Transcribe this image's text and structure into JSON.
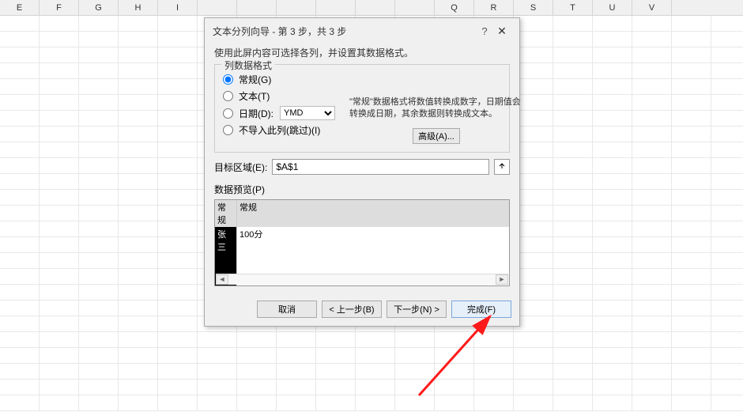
{
  "columns": [
    "E",
    "F",
    "G",
    "H",
    "I",
    "",
    "",
    "",
    "",
    "",
    "",
    "Q",
    "R",
    "S",
    "T",
    "U",
    "V"
  ],
  "dialog": {
    "title": "文本分列向导 - 第 3 步，共 3 步",
    "help": "?",
    "close": "✕",
    "hint": "使用此屏内容可选择各列，并设置其数据格式。",
    "format_legend": "列数据格式",
    "opt_general": "常规(G)",
    "opt_text": "文本(T)",
    "opt_date": "日期(D):",
    "date_value": "YMD",
    "opt_skip": "不导入此列(跳过)(I)",
    "desc": "\"常规\"数据格式将数值转换成数字，日期值会转换成日期，其余数据则转换成文本。",
    "advanced": "高级(A)...",
    "dest_label": "目标区域(E):",
    "dest_value": "$A$1",
    "preview_label": "数据预览(P)",
    "preview_h1": "常规",
    "preview_h2": "常规",
    "preview_r1c1": "张三",
    "preview_r1c2": "100分",
    "btn_cancel": "取消",
    "btn_back": "< 上一步(B)",
    "btn_next": "下一步(N) >",
    "btn_finish": "完成(F)"
  }
}
